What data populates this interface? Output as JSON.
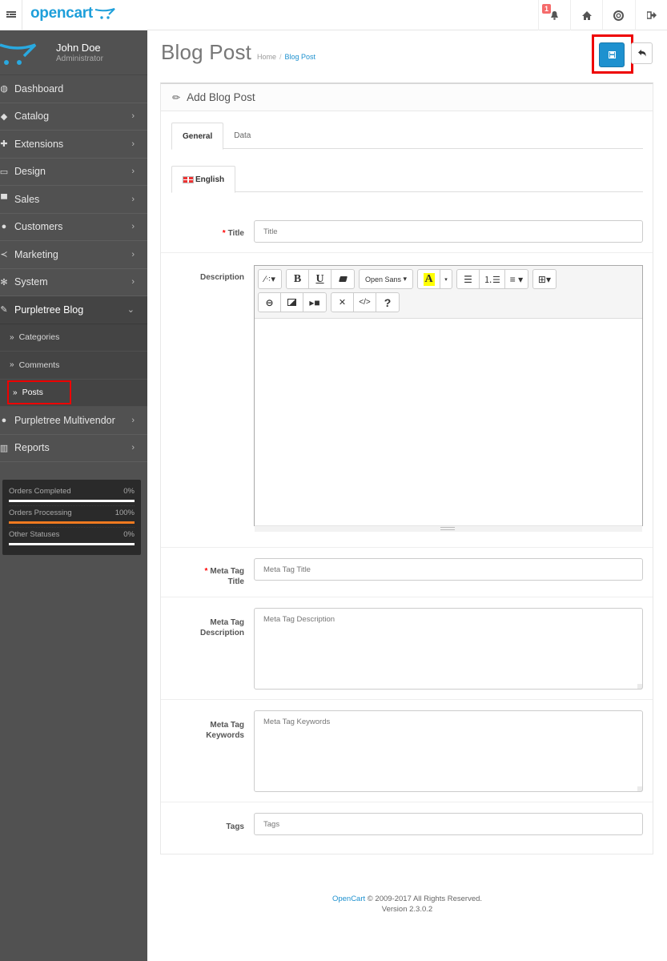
{
  "header": {
    "logo_text": "opencart",
    "notification_count": "1",
    "icons": [
      "menu-toggle-icon",
      "bell-icon",
      "home-icon",
      "life-ring-icon",
      "sign-out-icon"
    ]
  },
  "profile": {
    "name": "John Doe",
    "role": "Administrator"
  },
  "sidebar": {
    "items": [
      {
        "label": "Dashboard",
        "icon": "dashboard-icon",
        "has_children": false
      },
      {
        "label": "Catalog",
        "icon": "tag-icon",
        "has_children": true
      },
      {
        "label": "Extensions",
        "icon": "puzzle-icon",
        "has_children": true
      },
      {
        "label": "Design",
        "icon": "desktop-icon",
        "has_children": true
      },
      {
        "label": "Sales",
        "icon": "cart-icon",
        "has_children": true
      },
      {
        "label": "Customers",
        "icon": "user-icon",
        "has_children": true
      },
      {
        "label": "Marketing",
        "icon": "share-icon",
        "has_children": true
      },
      {
        "label": "System",
        "icon": "cog-icon",
        "has_children": true
      },
      {
        "label": "Purpletree Blog",
        "icon": "edit-icon",
        "has_children": true,
        "open": true,
        "children": [
          {
            "label": "Categories"
          },
          {
            "label": "Comments"
          },
          {
            "label": "Posts",
            "active": true
          }
        ]
      },
      {
        "label": "Purpletree Multivendor",
        "icon": "user-icon",
        "has_children": true
      },
      {
        "label": "Reports",
        "icon": "bar-chart-icon",
        "has_children": true
      }
    ]
  },
  "stats": [
    {
      "label": "Orders Completed",
      "value": "0%",
      "progress": 0
    },
    {
      "label": "Orders Processing",
      "value": "100%",
      "progress": 100
    },
    {
      "label": "Other Statuses",
      "value": "0%",
      "progress": 0
    }
  ],
  "page": {
    "title": "Blog Post",
    "breadcrumb": [
      {
        "label": "Home"
      },
      {
        "label": "Blog Post"
      }
    ],
    "save_tooltip": "Save",
    "back_tooltip": "Cancel"
  },
  "panel": {
    "heading": "Add Blog Post",
    "tabs": [
      {
        "label": "General",
        "active": true
      },
      {
        "label": "Data"
      }
    ],
    "language_tab": "English"
  },
  "form": {
    "title": {
      "label": "Title",
      "required": true,
      "placeholder": "Title",
      "value": ""
    },
    "description": {
      "label": "Description",
      "font_name": "Open Sans"
    },
    "meta_title": {
      "label_line1": "Meta Tag",
      "label_line2": "Title",
      "required": true,
      "placeholder": "Meta Tag Title"
    },
    "meta_description": {
      "label_line1": "Meta Tag",
      "label_line2": "Description",
      "placeholder": "Meta Tag Description"
    },
    "meta_keywords": {
      "label_line1": "Meta Tag",
      "label_line2": "Keywords",
      "placeholder": "Meta Tag Keywords"
    },
    "tags": {
      "label": "Tags",
      "placeholder": "Tags"
    }
  },
  "editor": {
    "toolbar_row1": [
      "magic-icon",
      "bold-icon",
      "underline-icon",
      "eraser-icon",
      "font-family-dropdown",
      "font-color-icon",
      "color-caret-icon",
      "unordered-list-icon",
      "ordered-list-icon",
      "paragraph-align-icon",
      "table-icon"
    ],
    "toolbar_row2": [
      "link-icon",
      "picture-icon",
      "video-icon",
      "fullscreen-icon",
      "code-view-icon",
      "help-icon"
    ],
    "bold": "B",
    "underline": "U",
    "color_letter": "A",
    "code": "</>",
    "help": "?"
  },
  "footer": {
    "link_text": "OpenCart",
    "copyright": " © 2009-2017 All Rights Reserved.",
    "version": "Version 2.3.0.2"
  },
  "colors": {
    "brand": "#1e9fda",
    "primary": "#1e91cf",
    "sidebar": "#515151",
    "progress": "#f07a20",
    "highlight": "#e00000"
  }
}
